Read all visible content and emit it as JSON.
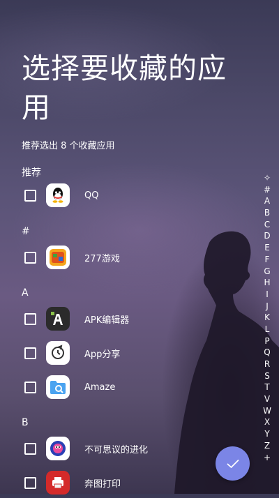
{
  "page": {
    "title": "选择要收藏的应用",
    "subtitle": "推荐选出 8 个收藏应用"
  },
  "sections": [
    {
      "header": "推荐",
      "apps": [
        {
          "name": "QQ",
          "icon": "qq-icon",
          "checked": false
        }
      ]
    },
    {
      "header": "#",
      "apps": [
        {
          "name": "277游戏",
          "icon": "277-game-icon",
          "checked": false
        }
      ]
    },
    {
      "header": "A",
      "apps": [
        {
          "name": "APK编辑器",
          "icon": "apk-editor-icon",
          "checked": false
        },
        {
          "name": "App分享",
          "icon": "app-share-icon",
          "checked": false
        },
        {
          "name": "Amaze",
          "icon": "amaze-folder-icon",
          "checked": false
        }
      ]
    },
    {
      "header": "B",
      "apps": [
        {
          "name": "不可思议的进化",
          "icon": "evolution-game-icon",
          "checked": false
        },
        {
          "name": "奔图打印",
          "icon": "pantum-print-icon",
          "checked": false
        }
      ]
    }
  ],
  "index_bar": [
    "✧",
    "#",
    "A",
    "B",
    "C",
    "D",
    "E",
    "F",
    "G",
    "H",
    "I",
    "J",
    "K",
    "L",
    "P",
    "Q",
    "R",
    "S",
    "T",
    "V",
    "W",
    "X",
    "Y",
    "Z",
    "+"
  ],
  "fab": {
    "icon": "checkmark-icon"
  },
  "colors": {
    "accent": "#7b85e6",
    "text": "#ffffff"
  }
}
